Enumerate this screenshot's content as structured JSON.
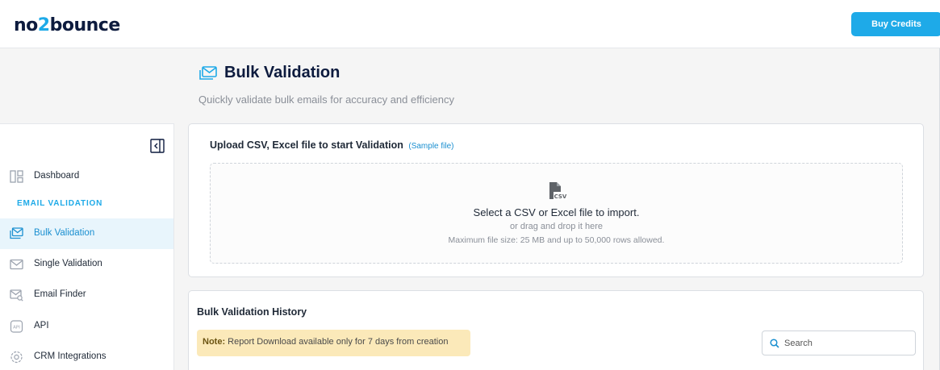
{
  "header": {
    "logo_part1": "no",
    "logo_part2": "2",
    "logo_part3": "bounce",
    "buy_credits_label": "Buy Credits"
  },
  "page": {
    "title": "Bulk Validation",
    "subtitle": "Quickly validate bulk emails for accuracy and efficiency"
  },
  "sidebar": {
    "section_label": "EMAIL VALIDATION",
    "items": [
      {
        "label": "Dashboard",
        "icon": "dashboard-icon"
      },
      {
        "label": "Bulk Validation",
        "icon": "mail-stack-icon",
        "active": true
      },
      {
        "label": "Single Validation",
        "icon": "mail-icon"
      },
      {
        "label": "Email Finder",
        "icon": "mail-search-icon"
      },
      {
        "label": "API",
        "icon": "api-icon"
      },
      {
        "label": "CRM Integrations",
        "icon": "integrations-icon"
      }
    ]
  },
  "upload": {
    "title": "Upload CSV, Excel file to start Validation",
    "sample_link": "(Sample file)",
    "icon_text": "CSV",
    "main_text": "Select a CSV or Excel file to import.",
    "sub_text": "or drag and drop it here",
    "limit_text": "Maximum file size: 25 MB and up to 50,000 rows allowed."
  },
  "history": {
    "title": "Bulk Validation History",
    "note_label": "Note:",
    "note_text": "Report Download available only for 7 days from creation",
    "search_placeholder": "Search"
  },
  "colors": {
    "accent": "#1eaae8",
    "brand_dark": "#0d1b3e",
    "active_bg": "#e8f5fc",
    "note_bg": "#fbe9b9"
  }
}
